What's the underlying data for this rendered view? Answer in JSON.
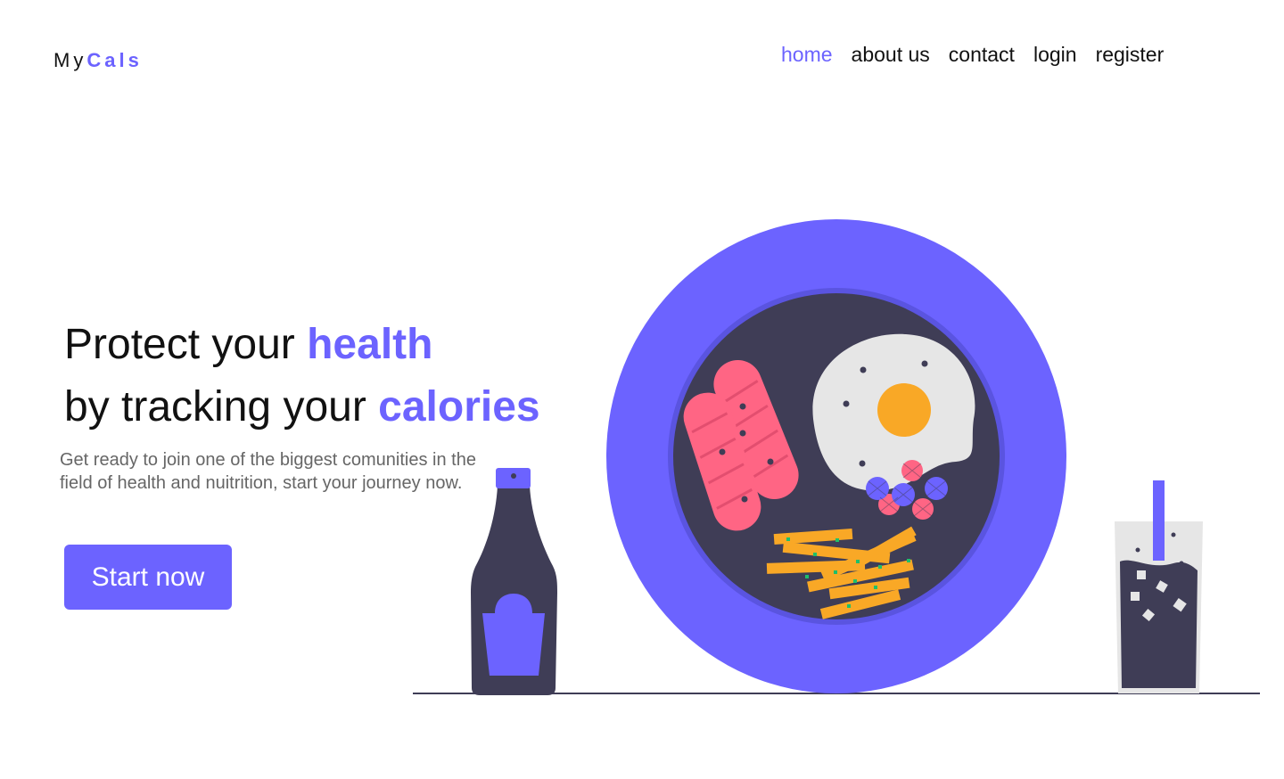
{
  "logo": {
    "prefix": "My",
    "accent": "Cals"
  },
  "nav": {
    "items": [
      {
        "label": "home",
        "active": true
      },
      {
        "label": "about us",
        "active": false
      },
      {
        "label": "contact",
        "active": false
      },
      {
        "label": "login",
        "active": false
      },
      {
        "label": "register",
        "active": false
      }
    ]
  },
  "hero": {
    "line1_prefix": "Protect your ",
    "line1_highlight": "health",
    "line2_prefix": "by tracking your ",
    "line2_highlight": "calories",
    "subtext": "Get ready to join one of the biggest comunities in the field of health and nuitrition, start your journey now.",
    "cta_label": "Start now"
  },
  "colors": {
    "accent": "#6c63ff",
    "dark": "#3f3d56",
    "sausage": "#ff6584",
    "yolk": "#f9a826",
    "egg_white": "#e6e6e6"
  }
}
